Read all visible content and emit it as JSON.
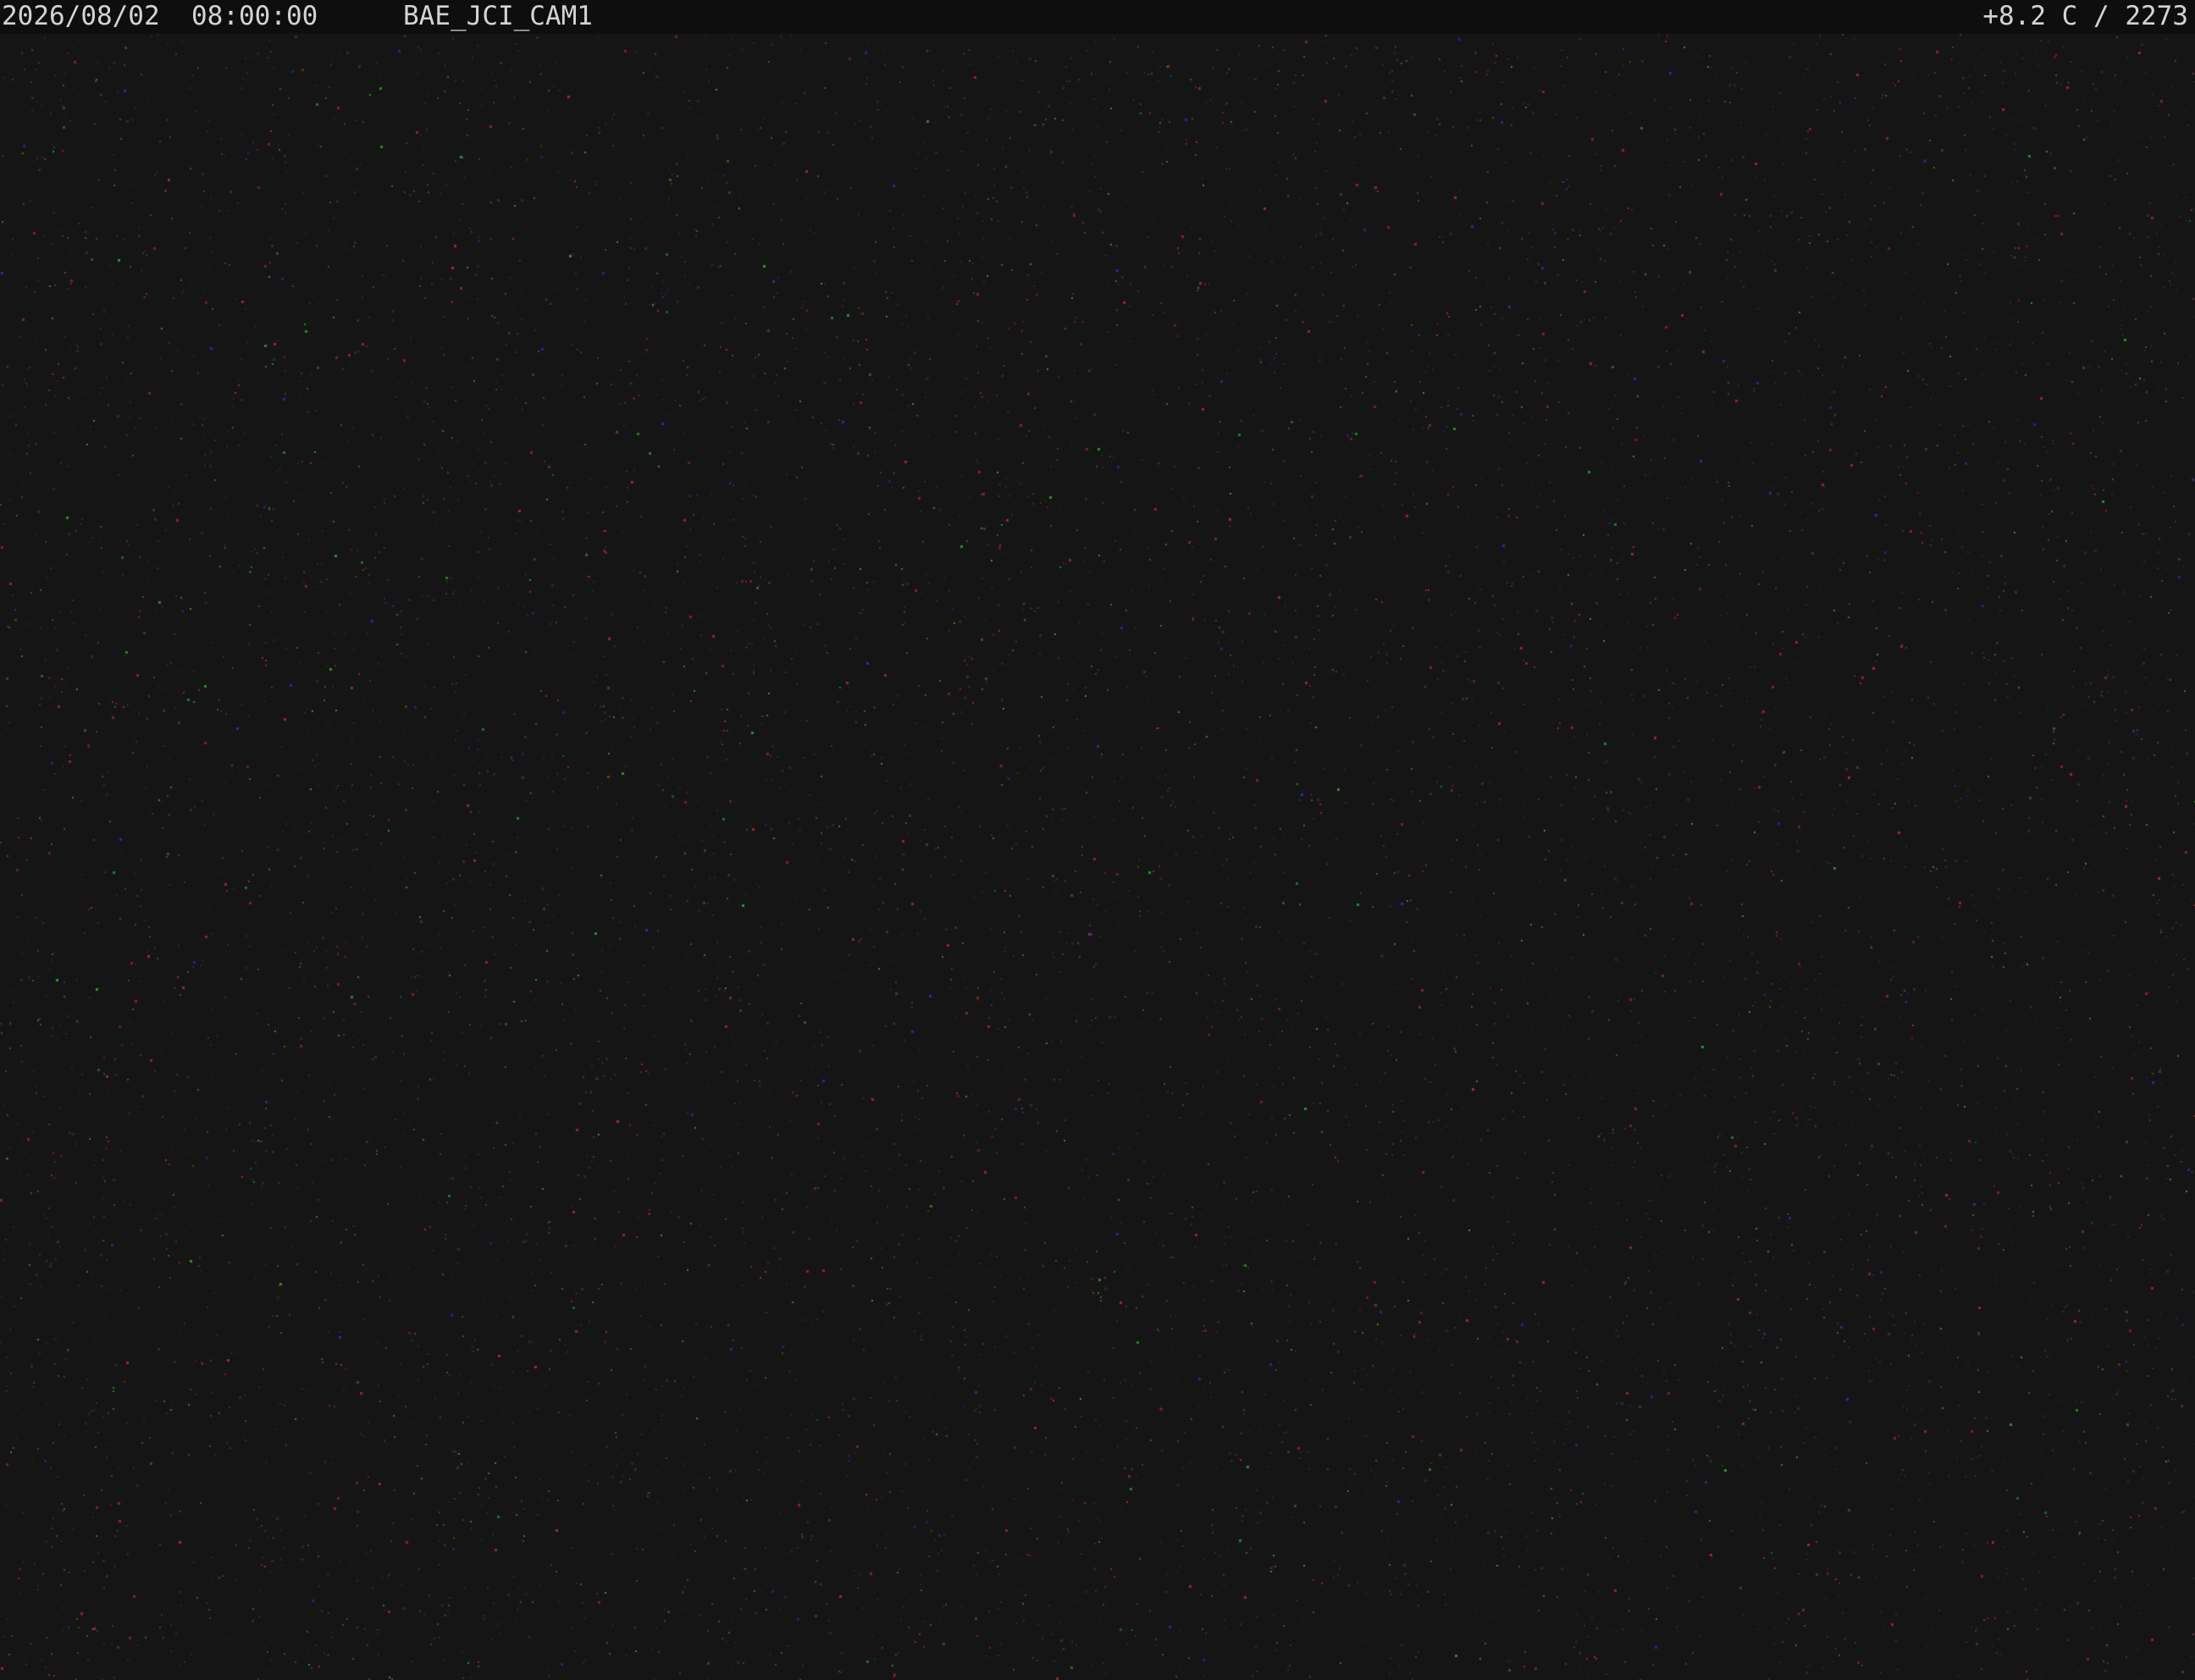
{
  "overlay": {
    "date": "2026/08/02",
    "time": "08:00:00",
    "camera_id": "BAE_JCI_CAM1",
    "temperature": "+8.2 C",
    "separator": "/",
    "counter": "2273"
  },
  "colors": {
    "background": "#151515",
    "overlay_bar": "#0e0e0e",
    "overlay_text": "#d4d4d4",
    "noise_red": "#a03030",
    "noise_blue": "#3030a0",
    "noise_green": "#30a030"
  }
}
